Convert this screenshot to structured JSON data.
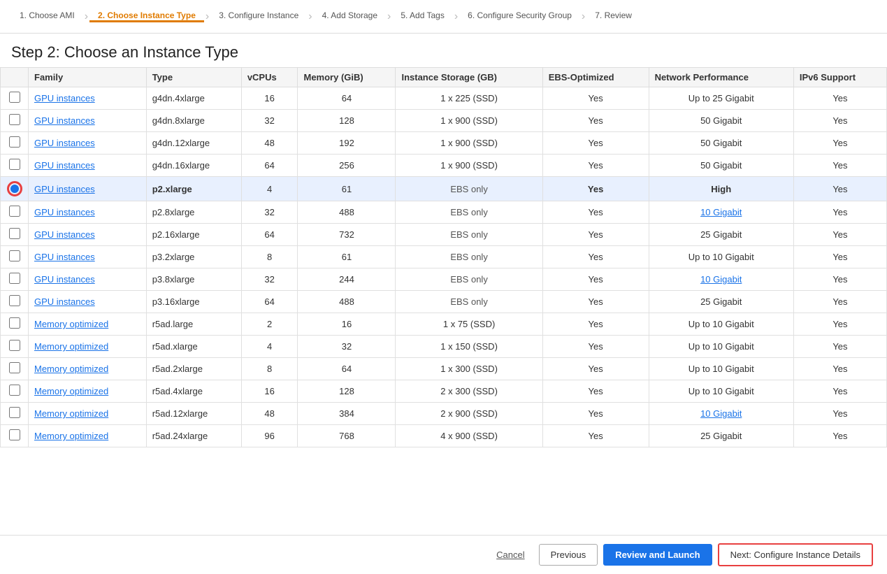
{
  "wizard": {
    "steps": [
      {
        "id": 1,
        "label": "1. Choose AMI",
        "active": false
      },
      {
        "id": 2,
        "label": "2. Choose Instance Type",
        "active": true
      },
      {
        "id": 3,
        "label": "3. Configure Instance",
        "active": false
      },
      {
        "id": 4,
        "label": "4. Add Storage",
        "active": false
      },
      {
        "id": 5,
        "label": "5. Add Tags",
        "active": false
      },
      {
        "id": 6,
        "label": "6. Configure Security Group",
        "active": false
      },
      {
        "id": 7,
        "label": "7. Review",
        "active": false
      }
    ]
  },
  "page": {
    "title": "Step 2: Choose an Instance Type"
  },
  "table": {
    "columns": [
      "",
      "Family",
      "Type",
      "vCPUs",
      "Memory (GiB)",
      "Instance Storage (GB)",
      "EBS-Optimized",
      "Network Performance",
      "IPv6 Support"
    ],
    "rows": [
      {
        "selected": false,
        "family": "GPU instances",
        "type": "g4dn.4xlarge",
        "vcpus": "16",
        "memory": "64",
        "storage": "1 x 225 (SSD)",
        "ebs": "Yes",
        "network": "Up to 25 Gigabit",
        "network_link": false,
        "ipv6": "Yes"
      },
      {
        "selected": false,
        "family": "GPU instances",
        "type": "g4dn.8xlarge",
        "vcpus": "32",
        "memory": "128",
        "storage": "1 x 900 (SSD)",
        "ebs": "Yes",
        "network": "50 Gigabit",
        "network_link": false,
        "ipv6": "Yes"
      },
      {
        "selected": false,
        "family": "GPU instances",
        "type": "g4dn.12xlarge",
        "vcpus": "48",
        "memory": "192",
        "storage": "1 x 900 (SSD)",
        "ebs": "Yes",
        "network": "50 Gigabit",
        "network_link": false,
        "ipv6": "Yes"
      },
      {
        "selected": false,
        "family": "GPU instances",
        "type": "g4dn.16xlarge",
        "vcpus": "64",
        "memory": "256",
        "storage": "1 x 900 (SSD)",
        "ebs": "Yes",
        "network": "50 Gigabit",
        "network_link": false,
        "ipv6": "Yes"
      },
      {
        "selected": true,
        "family": "GPU instances",
        "type": "p2.xlarge",
        "vcpus": "4",
        "memory": "61",
        "storage": "EBS only",
        "ebs": "Yes",
        "network": "High",
        "network_link": false,
        "ipv6": "Yes"
      },
      {
        "selected": false,
        "family": "GPU instances",
        "type": "p2.8xlarge",
        "vcpus": "32",
        "memory": "488",
        "storage": "EBS only",
        "ebs": "Yes",
        "network": "10 Gigabit",
        "network_link": true,
        "ipv6": "Yes"
      },
      {
        "selected": false,
        "family": "GPU instances",
        "type": "p2.16xlarge",
        "vcpus": "64",
        "memory": "732",
        "storage": "EBS only",
        "ebs": "Yes",
        "network": "25 Gigabit",
        "network_link": false,
        "ipv6": "Yes"
      },
      {
        "selected": false,
        "family": "GPU instances",
        "type": "p3.2xlarge",
        "vcpus": "8",
        "memory": "61",
        "storage": "EBS only",
        "ebs": "Yes",
        "network": "Up to 10 Gigabit",
        "network_link": false,
        "ipv6": "Yes"
      },
      {
        "selected": false,
        "family": "GPU instances",
        "type": "p3.8xlarge",
        "vcpus": "32",
        "memory": "244",
        "storage": "EBS only",
        "ebs": "Yes",
        "network": "10 Gigabit",
        "network_link": true,
        "ipv6": "Yes"
      },
      {
        "selected": false,
        "family": "GPU instances",
        "type": "p3.16xlarge",
        "vcpus": "64",
        "memory": "488",
        "storage": "EBS only",
        "ebs": "Yes",
        "network": "25 Gigabit",
        "network_link": false,
        "ipv6": "Yes"
      },
      {
        "selected": false,
        "family": "Memory optimized",
        "type": "r5ad.large",
        "vcpus": "2",
        "memory": "16",
        "storage": "1 x 75 (SSD)",
        "ebs": "Yes",
        "network": "Up to 10 Gigabit",
        "network_link": false,
        "ipv6": "Yes"
      },
      {
        "selected": false,
        "family": "Memory optimized",
        "type": "r5ad.xlarge",
        "vcpus": "4",
        "memory": "32",
        "storage": "1 x 150 (SSD)",
        "ebs": "Yes",
        "network": "Up to 10 Gigabit",
        "network_link": false,
        "ipv6": "Yes"
      },
      {
        "selected": false,
        "family": "Memory optimized",
        "type": "r5ad.2xlarge",
        "vcpus": "8",
        "memory": "64",
        "storage": "1 x 300 (SSD)",
        "ebs": "Yes",
        "network": "Up to 10 Gigabit",
        "network_link": false,
        "ipv6": "Yes"
      },
      {
        "selected": false,
        "family": "Memory optimized",
        "type": "r5ad.4xlarge",
        "vcpus": "16",
        "memory": "128",
        "storage": "2 x 300 (SSD)",
        "ebs": "Yes",
        "network": "Up to 10 Gigabit",
        "network_link": false,
        "ipv6": "Yes"
      },
      {
        "selected": false,
        "family": "Memory optimized",
        "type": "r5ad.12xlarge",
        "vcpus": "48",
        "memory": "384",
        "storage": "2 x 900 (SSD)",
        "ebs": "Yes",
        "network": "10 Gigabit",
        "network_link": true,
        "ipv6": "Yes"
      },
      {
        "selected": false,
        "family": "Memory optimized",
        "type": "r5ad.24xlarge",
        "vcpus": "96",
        "memory": "768",
        "storage": "4 x 900 (SSD)",
        "ebs": "Yes",
        "network": "25 Gigabit",
        "network_link": false,
        "ipv6": "Yes"
      }
    ]
  },
  "footer": {
    "cancel_label": "Cancel",
    "previous_label": "Previous",
    "review_label": "Review and Launch",
    "next_label": "Next: Configure Instance Details"
  }
}
